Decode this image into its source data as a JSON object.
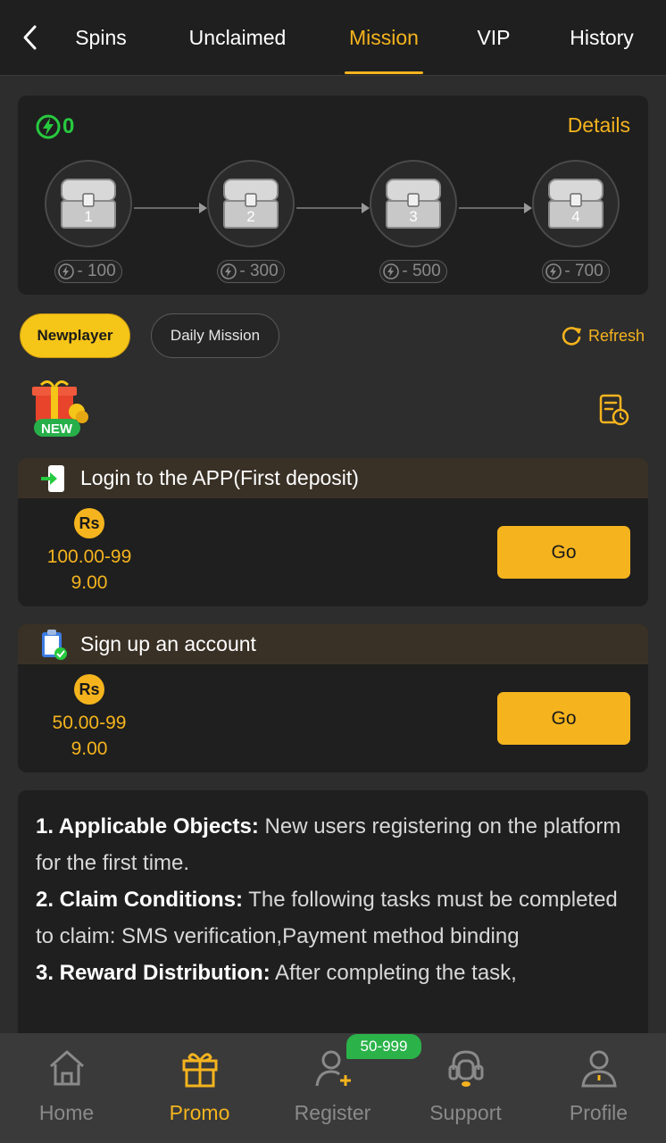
{
  "tabs": [
    {
      "label": "Spins"
    },
    {
      "label": "Unclaimed"
    },
    {
      "label": "Mission",
      "active": true
    },
    {
      "label": "VIP"
    },
    {
      "label": "History"
    }
  ],
  "chest_panel": {
    "energy_count": "0",
    "details_label": "Details",
    "chests": [
      {
        "number": "1",
        "cost": "- 100"
      },
      {
        "number": "2",
        "cost": "- 300"
      },
      {
        "number": "3",
        "cost": "- 500"
      },
      {
        "number": "4",
        "cost": "- 700"
      }
    ]
  },
  "filters": {
    "newplayer_label": "Newplayer",
    "daily_label": "Daily Mission",
    "refresh_label": "Refresh"
  },
  "new_badge": "NEW",
  "tasks": [
    {
      "title": "Login to the APP(First deposit)",
      "currency": "Rs",
      "amount_line1": "100.00-99",
      "amount_line2": "9.00",
      "button": "Go"
    },
    {
      "title": "Sign up an account",
      "currency": "Rs",
      "amount_line1": "50.00-99",
      "amount_line2": "9.00",
      "button": "Go"
    }
  ],
  "rules": [
    {
      "label": "1. Applicable Objects:",
      "text": " New users registering on the platform for the first time."
    },
    {
      "label": "2. Claim Conditions:",
      "text": " The following tasks must be completed to claim: SMS verification,Payment method binding"
    },
    {
      "label": "3. Reward Distribution:",
      "text": " After completing the task,"
    }
  ],
  "bottom_nav": [
    {
      "label": "Home",
      "icon": "home-icon"
    },
    {
      "label": "Promo",
      "icon": "gift-icon",
      "active": true
    },
    {
      "label": "Register",
      "icon": "add-user-icon"
    },
    {
      "label": "Support",
      "icon": "headset-icon"
    },
    {
      "label": "Profile",
      "icon": "user-icon"
    }
  ],
  "register_badge": "50-999",
  "colors": {
    "accent": "#f5b41e",
    "energy": "#27c93f",
    "badge": "#2bb34a"
  }
}
